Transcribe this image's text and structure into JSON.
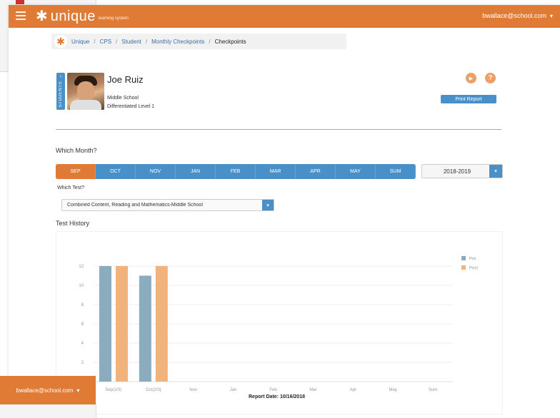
{
  "app": {
    "logo_text": "unique",
    "logo_tagline": "learning system",
    "user_email": "bwallace@school.com"
  },
  "breadcrumb": {
    "items": [
      "Unique",
      "CPS",
      "Student",
      "Monthly Checkpoints"
    ],
    "current": "Checkpoints"
  },
  "student": {
    "tab_label": "STUDENTS",
    "name": "Joe Ruiz",
    "school": "Middle School",
    "level": "Differentiated Level 1"
  },
  "actions": {
    "print_label": "Print Report"
  },
  "month_section": {
    "heading": "Which Month?",
    "months": [
      "SEP",
      "OCT",
      "NOV",
      "JAN",
      "FEB",
      "MAR",
      "APR",
      "MAY",
      "SUM"
    ],
    "active_month": "SEP",
    "year_value": "2018-2019"
  },
  "test_section": {
    "heading": "Which Test?",
    "selected_test": "Combined Content, Reading and Mathematics-Middle School"
  },
  "history": {
    "heading": "Test History",
    "report_date": "Report Date: 10/16/2018"
  },
  "colors": {
    "brand_orange": "#e07b35",
    "nav_blue": "#4a90c8",
    "pre_bar": "#8aacbe",
    "post_bar": "#f2b27c"
  },
  "chart_data": {
    "type": "bar",
    "categories": [
      "Sep(2/3)",
      "Oct(2/3)",
      "Nov",
      "Jan",
      "Feb",
      "Mar",
      "Apr",
      "May",
      "Sum"
    ],
    "series": [
      {
        "name": "Pre",
        "values": [
          12,
          11,
          null,
          null,
          null,
          null,
          null,
          null,
          null
        ]
      },
      {
        "name": "Post",
        "values": [
          12,
          12,
          null,
          null,
          null,
          null,
          null,
          null,
          null
        ]
      }
    ],
    "yticks": [
      "2",
      "4",
      "6",
      "8",
      "10",
      "12"
    ],
    "ylim": [
      0,
      12
    ],
    "legend_position": "top-right",
    "grid": true
  }
}
